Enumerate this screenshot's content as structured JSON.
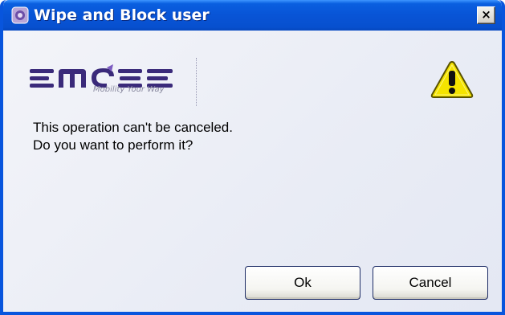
{
  "window": {
    "title": "Wipe and Block user",
    "close_label": "×",
    "app_icon": "app-icon",
    "accent_color": "#0855dd"
  },
  "logo": {
    "brand": "EMOZE",
    "tagline": "Mobility Your Way",
    "brand_color": "#3a2a7a"
  },
  "warning": {
    "icon": "warning-icon",
    "symbol": "!",
    "color": "#f5e400"
  },
  "message": {
    "line1": "This operation can't be canceled.",
    "line2": "Do you want to perform it?"
  },
  "buttons": {
    "ok_label": "Ok",
    "cancel_label": "Cancel"
  }
}
